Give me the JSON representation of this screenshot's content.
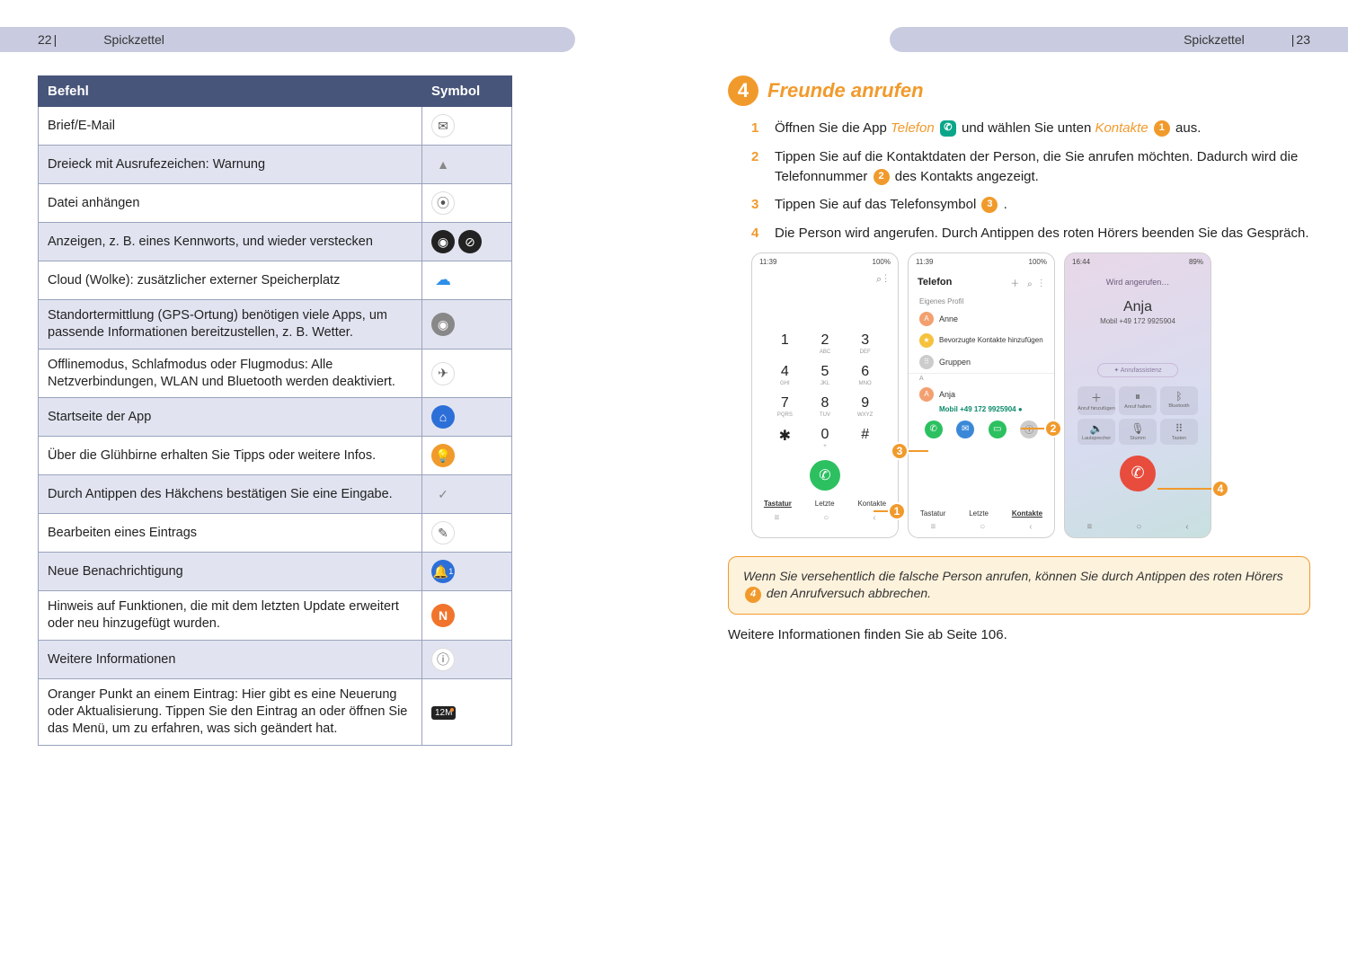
{
  "left": {
    "page_number": "22",
    "header": "Spickzettel",
    "table": {
      "col_command": "Befehl",
      "col_symbol": "Symbol",
      "rows": {
        "r0": "Brief/E-Mail",
        "r1": "Dreieck mit Ausrufezeichen: Warnung",
        "r2": "Datei anhängen",
        "r3": "Anzeigen, z. B. eines Kennworts, und wieder verstecken",
        "r4": "Cloud (Wolke): zusätzlicher externer Speicherplatz",
        "r5": "Standortermittlung (GPS-Ortung) benötigen viele Apps, um passende Informationen bereitzustellen, z. B. Wetter.",
        "r6": "Offlinemodus, Schlafmodus oder Flugmodus: Alle Netzverbindungen, WLAN und Bluetooth werden deaktiviert.",
        "r7": "Startseite der App",
        "r8": "Über die Glühbirne erhalten Sie Tipps oder weitere Infos.",
        "r9": "Durch Antippen des Häkchens bestätigen Sie eine Eingabe.",
        "r10": "Bearbeiten eines Eintrags",
        "r11": "Neue Benachrichtigung",
        "r12": "Hinweis auf Funktionen, die mit dem letzten Update erweitert oder neu hinzugefügt wurden.",
        "r13": "Weitere Informationen",
        "r14": "Oranger Punkt an einem Eintrag: Hier gibt es eine Neuerung oder Aktualisierung. Tippen Sie den Eintrag an oder öffnen Sie das Menü, um zu erfahren, was sich geändert hat."
      },
      "symbols": {
        "s11": "1",
        "s12": "N",
        "s14": "12M"
      }
    }
  },
  "right": {
    "page_number": "23",
    "header": "Spickzettel",
    "section_num": "4",
    "section_title": "Freunde anrufen",
    "steps": {
      "s1a": "Öffnen Sie die App ",
      "s1_kw1": "Telefon",
      "s1b": " und wählen Sie unten ",
      "s1_kw2": "Kontakte",
      "s1c": " aus.",
      "s2a": "Tippen Sie auf die Kontaktdaten der Person, die Sie anrufen möchten. Dadurch wird die Telefonnummer ",
      "s2b": " des Kontakts angezeigt.",
      "s3a": "Tippen Sie auf das Telefonsymbol ",
      "s3b": " .",
      "s4": "Die Person wird angerufen. Durch Antippen des roten Hörers beenden Sie das Gespräch."
    },
    "phone1": {
      "time": "11:39",
      "status": "100%",
      "search": "⌕  ⋮",
      "keys": [
        "1",
        "2",
        "3",
        "4",
        "5",
        "6",
        "7",
        "8",
        "9",
        "✱",
        "0",
        "#"
      ],
      "sub": [
        "",
        "ABC",
        "DEF",
        "GHI",
        "JKL",
        "MNO",
        "PQRS",
        "TUV",
        "WXYZ",
        "",
        "+",
        ""
      ],
      "tab1": "Tastatur",
      "tab2": "Letzte",
      "tab3": "Kontakte"
    },
    "phone2": {
      "time": "11:39",
      "status": "100%",
      "title": "Telefon",
      "icons": "＋ ⌕ ⋮",
      "own": "Eigenes Profil",
      "anne": "Anne",
      "fav": "Bevorzugte Kontakte hinzufügen",
      "groups": "Gruppen",
      "sect": "A",
      "anja": "Anja",
      "anja_num": "Mobil +49 172 9925904 ●",
      "tab1": "Tastatur",
      "tab2": "Letzte",
      "tab3": "Kontakte"
    },
    "phone3": {
      "time": "16:44",
      "status": "89%",
      "calling": "Wird angerufen…",
      "name": "Anja",
      "num": "Mobil +49 172 9925904",
      "assist": "✦ Anrufassistenz",
      "btns": {
        "b1": "Anruf hinzufügen",
        "b2": "Anruf halten",
        "b3": "Bluetooth",
        "b4": "Lautsprecher",
        "b5": "Stumm",
        "b6": "Tasten"
      }
    },
    "tip_a": "Wenn Sie versehentlich die falsche Person anrufen, können Sie durch Antippen des roten Hörers ",
    "tip_b": " den Anrufversuch abbrechen.",
    "more": "Weitere Informationen finden Sie ab Seite 106."
  }
}
